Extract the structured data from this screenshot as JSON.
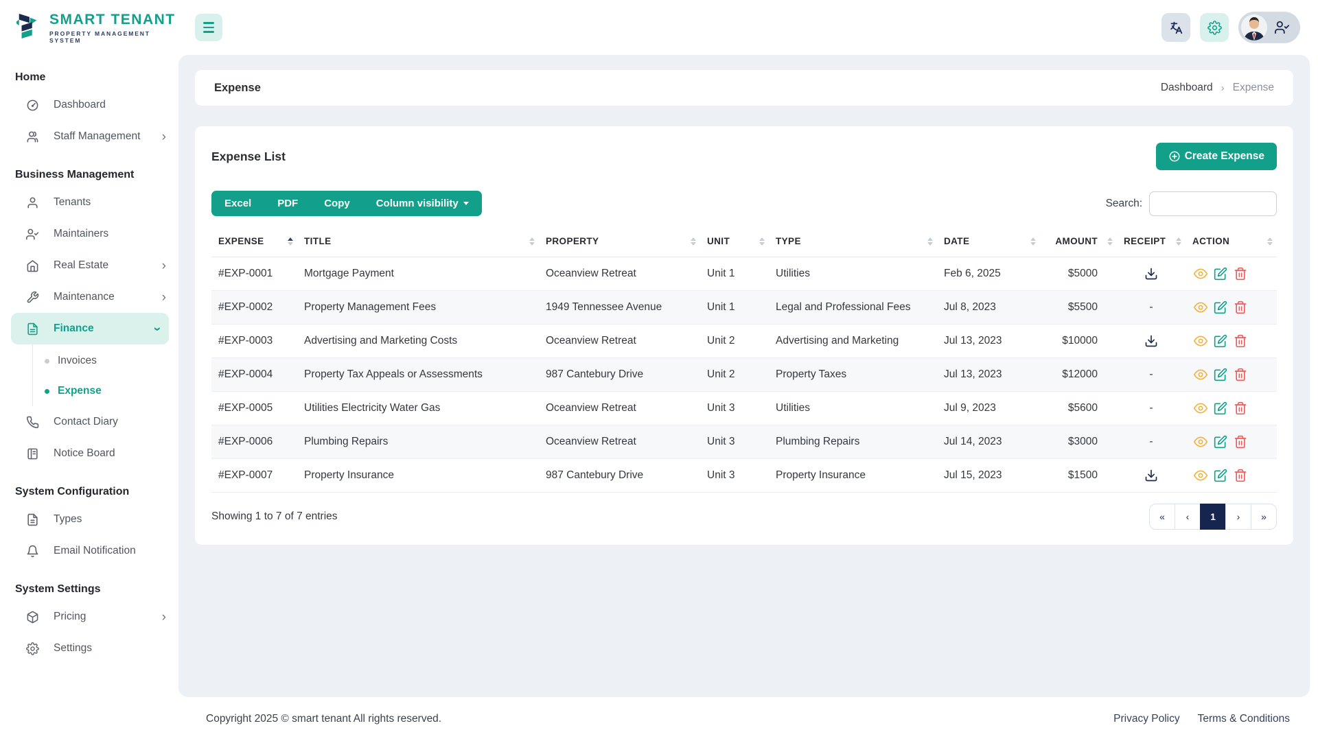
{
  "brand": {
    "name": "SMART TENANT",
    "tagline": "PROPERTY MANAGEMENT SYSTEM"
  },
  "sidebar": {
    "sections": [
      {
        "title": "Home",
        "items": [
          {
            "label": "Dashboard",
            "icon": "dashboard-icon"
          },
          {
            "label": "Staff Management",
            "icon": "users-icon",
            "chevron": "›"
          }
        ]
      },
      {
        "title": "Business Management",
        "items": [
          {
            "label": "Tenants",
            "icon": "user-icon"
          },
          {
            "label": "Maintainers",
            "icon": "user-check-icon"
          },
          {
            "label": "Real Estate",
            "icon": "home-icon",
            "chevron": "›"
          },
          {
            "label": "Maintenance",
            "icon": "wrench-icon",
            "chevron": "›"
          },
          {
            "label": "Finance",
            "icon": "file-invoice-icon",
            "chevron": "›",
            "expanded": true,
            "active": true,
            "children": [
              {
                "label": "Invoices",
                "active": false
              },
              {
                "label": "Expense",
                "active": true
              }
            ]
          },
          {
            "label": "Contact Diary",
            "icon": "phone-icon"
          },
          {
            "label": "Notice Board",
            "icon": "notice-board-icon"
          }
        ]
      },
      {
        "title": "System Configuration",
        "items": [
          {
            "label": "Types",
            "icon": "document-icon"
          },
          {
            "label": "Email Notification",
            "icon": "bell-icon"
          }
        ]
      },
      {
        "title": "System Settings",
        "items": [
          {
            "label": "Pricing",
            "icon": "package-icon",
            "chevron": "›"
          },
          {
            "label": "Settings",
            "icon": "gear-icon"
          }
        ]
      }
    ]
  },
  "page": {
    "title": "Expense",
    "breadcrumb": {
      "home": "Dashboard",
      "separator": "›",
      "current": "Expense"
    }
  },
  "expense_card": {
    "title": "Expense List",
    "create_button": "Create Expense",
    "toolbar": {
      "excel": "Excel",
      "pdf": "PDF",
      "copy": "Copy",
      "column_visibility": "Column visibility"
    },
    "search_label": "Search:",
    "search_value": "",
    "table": {
      "columns": [
        {
          "label": "Expense",
          "sorted": "asc"
        },
        {
          "label": "Title"
        },
        {
          "label": "Property"
        },
        {
          "label": "Unit"
        },
        {
          "label": "Type"
        },
        {
          "label": "Date"
        },
        {
          "label": "Amount"
        },
        {
          "label": "Receipt"
        },
        {
          "label": "Action"
        }
      ],
      "rows": [
        {
          "id": "#EXP-0001",
          "title": "Mortgage Payment",
          "property": "Oceanview Retreat",
          "unit": "Unit 1",
          "type": "Utilities",
          "date": "Feb 6, 2025",
          "amount": "$5000",
          "receipt": "download"
        },
        {
          "id": "#EXP-0002",
          "title": "Property Management Fees",
          "property": "1949 Tennessee Avenue",
          "unit": "Unit 1",
          "type": "Legal and Professional Fees",
          "date": "Jul 8, 2023",
          "amount": "$5500",
          "receipt": "-"
        },
        {
          "id": "#EXP-0003",
          "title": "Advertising and Marketing Costs",
          "property": "Oceanview Retreat",
          "unit": "Unit 2",
          "type": "Advertising and Marketing",
          "date": "Jul 13, 2023",
          "amount": "$10000",
          "receipt": "download"
        },
        {
          "id": "#EXP-0004",
          "title": "Property Tax Appeals or Assessments",
          "property": "987 Cantebury Drive",
          "unit": "Unit 2",
          "type": "Property Taxes",
          "date": "Jul 13, 2023",
          "amount": "$12000",
          "receipt": "-"
        },
        {
          "id": "#EXP-0005",
          "title": "Utilities Electricity Water Gas",
          "property": "Oceanview Retreat",
          "unit": "Unit 3",
          "type": "Utilities",
          "date": "Jul 9, 2023",
          "amount": "$5600",
          "receipt": "-"
        },
        {
          "id": "#EXP-0006",
          "title": "Plumbing Repairs",
          "property": "Oceanview Retreat",
          "unit": "Unit 3",
          "type": "Plumbing Repairs",
          "date": "Jul 14, 2023",
          "amount": "$3000",
          "receipt": "-"
        },
        {
          "id": "#EXP-0007",
          "title": "Property Insurance",
          "property": "987 Cantebury Drive",
          "unit": "Unit 3",
          "type": "Property Insurance",
          "date": "Jul 15, 2023",
          "amount": "$1500",
          "receipt": "download"
        }
      ]
    },
    "summary": "Showing 1 to 7 of 7 entries",
    "pagination": {
      "first": "«",
      "prev": "‹",
      "page": "1",
      "next": "›",
      "last": "»",
      "active_page": "1"
    }
  },
  "footer": {
    "copyright": "Copyright 2025 © smart tenant All rights reserved.",
    "links": [
      "Privacy Policy",
      "Terms & Conditions"
    ]
  },
  "colors": {
    "primary_teal": "#12a08a",
    "mint": "#d8f1ec",
    "navy": "#16254d",
    "eye_yellow": "#f2b33d",
    "edit_teal": "#12a08a",
    "delete_red": "#f15b5b",
    "content_bg": "#edf1f6"
  }
}
